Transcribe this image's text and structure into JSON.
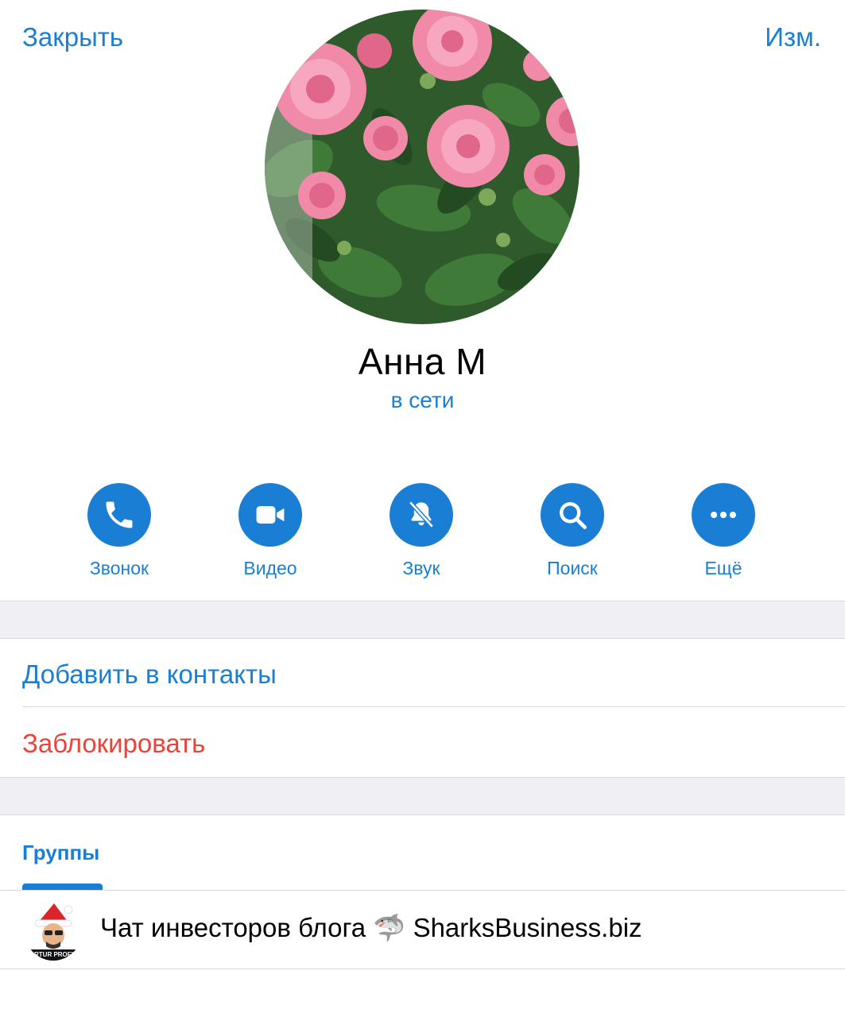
{
  "nav": {
    "close_label": "Закрыть",
    "edit_label": "Изм."
  },
  "profile": {
    "name": "Анна М",
    "status": "в сети",
    "avatar_icon": "roses-photo"
  },
  "actions": [
    {
      "label": "Звонок",
      "icon": "phone-icon"
    },
    {
      "label": "Видео",
      "icon": "video-icon"
    },
    {
      "label": "Звук",
      "icon": "bell-muted-icon"
    },
    {
      "label": "Поиск",
      "icon": "search-icon"
    },
    {
      "label": "Ещё",
      "icon": "more-icon"
    }
  ],
  "menu": {
    "add_contact_label": "Добавить в контакты",
    "block_label": "Заблокировать"
  },
  "tabs": {
    "groups_label": "Группы"
  },
  "groups": [
    {
      "title": "Чат инвесторов блога 🦈 SharksBusiness.biz",
      "avatar_text": "ARTUR PROFIT"
    }
  ],
  "colors": {
    "accent": "#1a7fd4",
    "destructive": "#e8443a",
    "separator": "#efeff4"
  }
}
